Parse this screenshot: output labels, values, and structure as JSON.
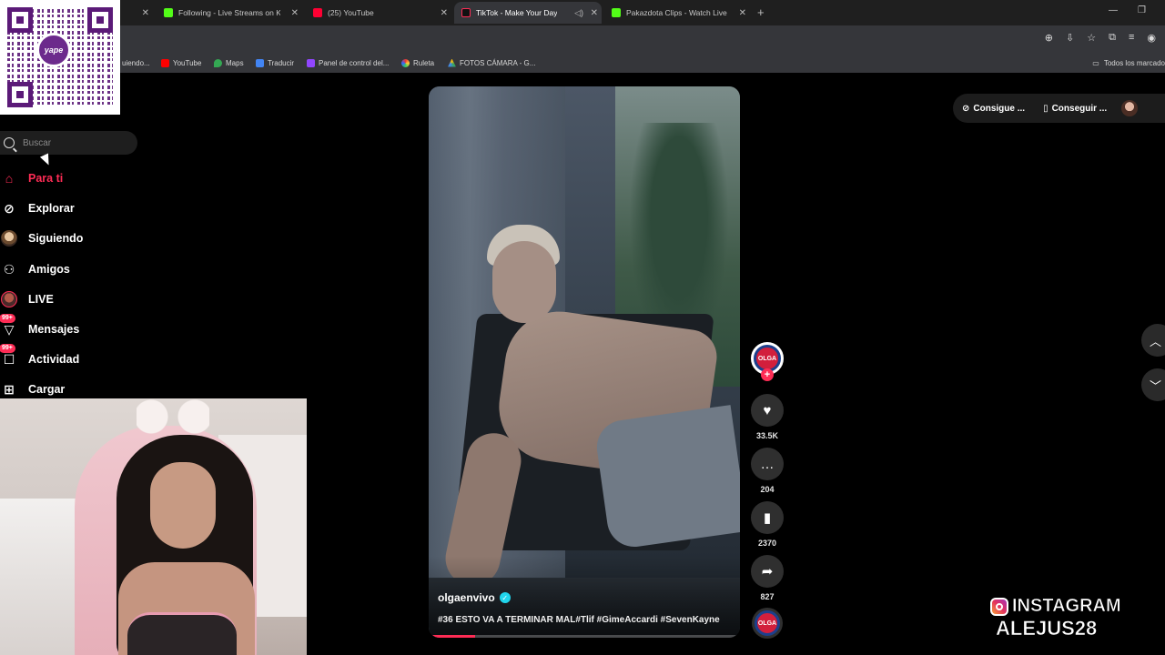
{
  "tabs": [
    {
      "label": "",
      "icon": "kick-icon"
    },
    {
      "label": "Following - Live Streams on Kick",
      "icon": "kick-icon"
    },
    {
      "label": "(25) YouTube",
      "icon": "youtube-icon"
    },
    {
      "label": "TikTok - Make Your Day",
      "icon": "tiktok-icon",
      "active": true
    },
    {
      "label": "Pakazdota Clips - Watch Live on Kick",
      "icon": "kick-icon"
    }
  ],
  "bookmarks": [
    {
      "label": "uiendo...",
      "color": "#888888"
    },
    {
      "label": "YouTube",
      "color": "#ff0000"
    },
    {
      "label": "Maps",
      "color": "#34a853"
    },
    {
      "label": "Traducir",
      "color": "#4285f4"
    },
    {
      "label": "Panel de control del...",
      "color": "#9146ff"
    },
    {
      "label": "Ruleta",
      "color": "#e0a030"
    },
    {
      "label": "FOTOS CÁMARA - G...",
      "color": "#fbbc04"
    }
  ],
  "bookmarks_all": "Todos los marcado",
  "qr": {
    "brand": "yape"
  },
  "search": {
    "placeholder": "Buscar"
  },
  "nav": [
    {
      "label": "Para ti",
      "icon": "home-icon",
      "active": true
    },
    {
      "label": "Explorar",
      "icon": "compass-icon"
    },
    {
      "label": "Siguiendo",
      "icon": "following-avatar-icon"
    },
    {
      "label": "Amigos",
      "icon": "friends-icon"
    },
    {
      "label": "LIVE",
      "icon": "live-avatar-icon"
    },
    {
      "label": "Mensajes",
      "icon": "messages-icon",
      "badge": "99+"
    },
    {
      "label": "Actividad",
      "icon": "activity-icon",
      "badge": "99+"
    },
    {
      "label": "Cargar",
      "icon": "upload-icon"
    }
  ],
  "video": {
    "author": "olgaenvivo",
    "verified": true,
    "caption": "#36 ESTO VA A TERMINAR MAL#Tlif #GimeAccardi #SevenKayne",
    "progress": 0.14,
    "profile_badge": "OLGA"
  },
  "actions": {
    "likes": "33.5K",
    "comments": "204",
    "saves": "2370",
    "shares": "827"
  },
  "top_pills": {
    "coins": "Consigue ...",
    "app": "Conseguir ..."
  },
  "watermark": {
    "line1": "INSTAGRAM",
    "line2": "ALEJUS28"
  },
  "colors": {
    "accent": "#fe2c55",
    "verified": "#20d5ec"
  }
}
